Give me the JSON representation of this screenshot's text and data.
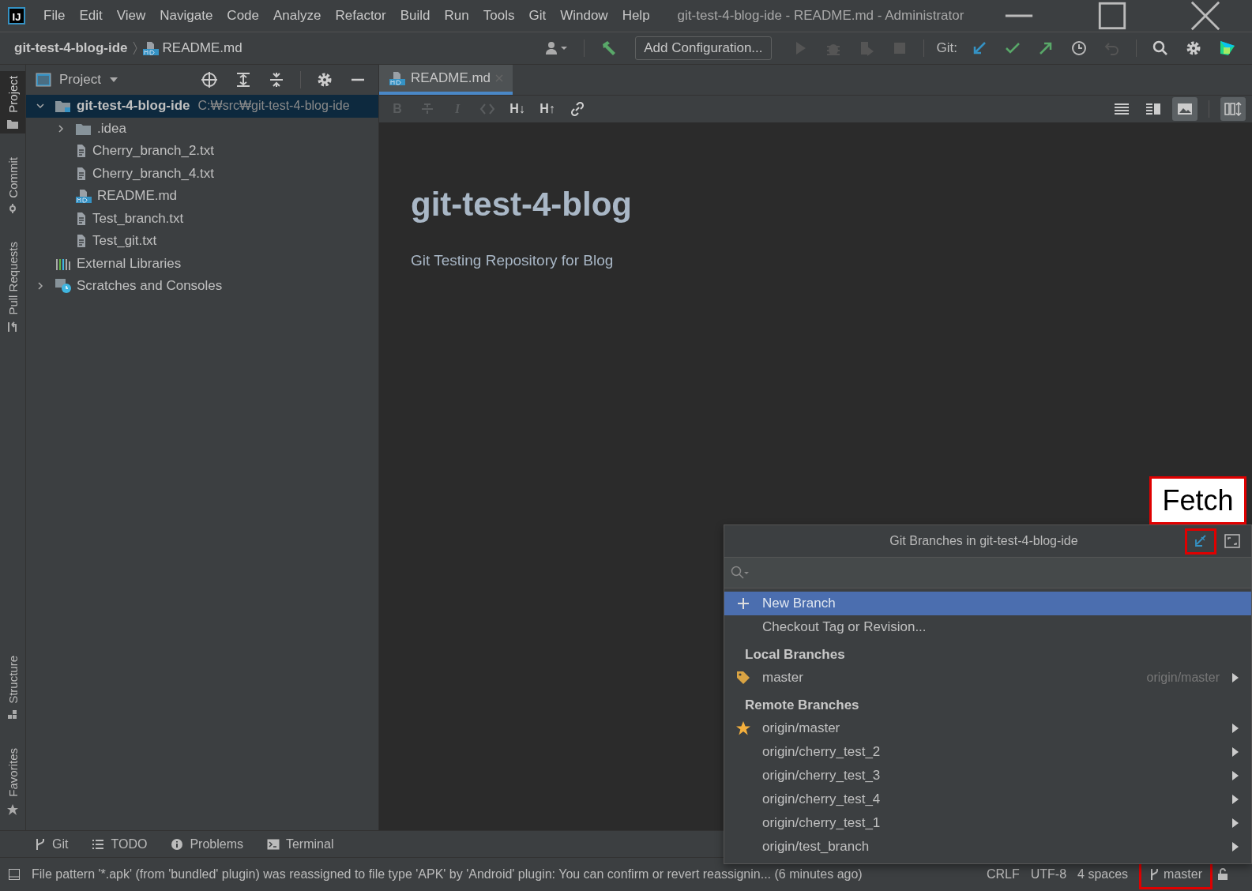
{
  "app_logo": "IJ",
  "menu": [
    "File",
    "Edit",
    "View",
    "Navigate",
    "Code",
    "Analyze",
    "Refactor",
    "Build",
    "Run",
    "Tools",
    "Git",
    "Window",
    "Help"
  ],
  "window": {
    "title": "git-test-4-blog-ide - README.md - Administrator"
  },
  "breadcrumbs": [
    {
      "label": "git-test-4-blog-ide",
      "kind": "project"
    },
    {
      "label": "README.md",
      "kind": "markdown"
    }
  ],
  "toolbar": {
    "run_config": "Add Configuration...",
    "git_label": "Git:"
  },
  "left_tabs": [
    {
      "label": "Project",
      "kind": "project",
      "selected": true
    },
    {
      "label": "Commit",
      "kind": "commit",
      "selected": false
    },
    {
      "label": "Pull Requests",
      "kind": "pull",
      "selected": false
    }
  ],
  "left_tabs_bottom": [
    {
      "label": "Structure",
      "kind": "structure",
      "selected": false
    },
    {
      "label": "Favorites",
      "kind": "favorites",
      "selected": false
    }
  ],
  "project_panel": {
    "title": "Project",
    "tree": [
      {
        "label": "git-test-4-blog-ide",
        "path": "C:₩src₩git-test-4-blog-ide",
        "kind": "module",
        "expanded": true,
        "selected": true,
        "children": [
          {
            "label": ".idea",
            "kind": "folder",
            "expanded": false,
            "selected": false
          },
          {
            "label": "Cherry_branch_2.txt",
            "kind": "text",
            "selected": false
          },
          {
            "label": "Cherry_branch_4.txt",
            "kind": "text",
            "selected": false
          },
          {
            "label": "README.md",
            "kind": "markdown",
            "selected": false
          },
          {
            "label": "Test_branch.txt",
            "kind": "text",
            "selected": false
          },
          {
            "label": "Test_git.txt",
            "kind": "text",
            "selected": false
          }
        ]
      },
      {
        "label": "External Libraries",
        "kind": "libraries",
        "selected": false
      },
      {
        "label": "Scratches and Consoles",
        "kind": "scratches",
        "expanded": false,
        "selected": false
      }
    ]
  },
  "editor": {
    "tabs": [
      {
        "label": "README.md",
        "selected": true
      }
    ],
    "format_tools": [
      {
        "kind": "bold",
        "label": "B",
        "disabled": true
      },
      {
        "kind": "strike",
        "disabled": true
      },
      {
        "kind": "italic",
        "label": "I",
        "disabled": true
      },
      {
        "kind": "code",
        "disabled": true
      },
      {
        "kind": "header",
        "label": "H↓",
        "disabled": false
      },
      {
        "kind": "header",
        "label": "H↑",
        "disabled": false
      },
      {
        "kind": "link",
        "disabled": false
      }
    ],
    "view_modes": [
      {
        "kind": "editor",
        "selected": false
      },
      {
        "kind": "split",
        "selected": false
      },
      {
        "kind": "preview",
        "selected": true
      }
    ],
    "scroll_sync": {
      "on": true
    },
    "heading": "git-test-4-blog",
    "paragraph": "Git Testing Repository for Blog"
  },
  "bottom_tabs": [
    {
      "label": "Git",
      "kind": "git"
    },
    {
      "label": "TODO",
      "kind": "todo"
    },
    {
      "label": "Problems",
      "kind": "problems"
    },
    {
      "label": "Terminal",
      "kind": "terminal"
    }
  ],
  "status_bar": {
    "message": "File pattern '*.apk' (from 'bundled' plugin) was reassigned to file type 'APK' by 'Android' plugin: You can confirm or revert reassignin... (6 minutes ago)",
    "line_separator": "CRLF",
    "encoding": "UTF-8",
    "indent": "4 spaces",
    "branch": "master"
  },
  "branches_popup": {
    "title": "Git Branches in git-test-4-blog-ide",
    "actions": [
      {
        "label": "New Branch",
        "kind": "new",
        "selected": true
      },
      {
        "label": "Checkout Tag or Revision...",
        "kind": "checkout",
        "selected": false
      }
    ],
    "groups": [
      {
        "title": "Local Branches",
        "branches": [
          {
            "name": "master",
            "tracking": "origin/master",
            "kind": "current"
          }
        ]
      },
      {
        "title": "Remote Branches",
        "branches": [
          {
            "name": "origin/master",
            "kind": "favorite"
          },
          {
            "name": "origin/cherry_test_2",
            "kind": "plain"
          },
          {
            "name": "origin/cherry_test_3",
            "kind": "plain"
          },
          {
            "name": "origin/cherry_test_4",
            "kind": "plain"
          },
          {
            "name": "origin/cherry_test_1",
            "kind": "plain"
          },
          {
            "name": "origin/test_branch",
            "kind": "plain"
          }
        ]
      }
    ]
  },
  "callout": {
    "label": "Fetch"
  }
}
